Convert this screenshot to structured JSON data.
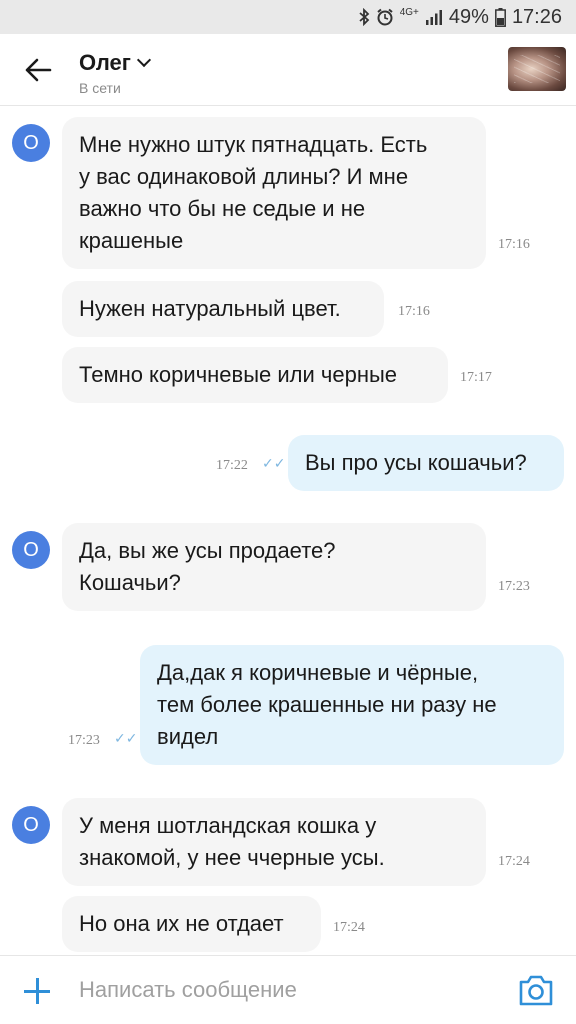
{
  "status_bar": {
    "network": "4G+",
    "battery": "49%",
    "time": "17:26"
  },
  "header": {
    "contact_name": "Олег",
    "contact_status": "В сети"
  },
  "messages": [
    {
      "direction": "in",
      "text": "Мне нужно штук пятнадцать. Есть\nу вас одинаковой длины? И мне\nважно что бы не седые и не\nкрашеные",
      "time": "17:16",
      "avatar_letter": "O"
    },
    {
      "direction": "in",
      "text": "Нужен натуральный цвет.",
      "time": "17:16"
    },
    {
      "direction": "in",
      "text": "Темно коричневые или черные",
      "time": "17:17"
    },
    {
      "direction": "out",
      "text": "Вы про усы кошачьи?",
      "time": "17:22",
      "status": "read"
    },
    {
      "direction": "in",
      "text": "Да, вы же усы продаете?\nКошачьи?",
      "time": "17:23",
      "avatar_letter": "O"
    },
    {
      "direction": "out",
      "text": "Да,дак я коричневые и чёрные,\nтем более крашенные ни разу не\nвидел",
      "time": "17:23",
      "status": "read"
    },
    {
      "direction": "in",
      "text": "У меня шотландская кошка у\nзнакомой, у нее ччерные усы.",
      "time": "17:24",
      "avatar_letter": "O"
    },
    {
      "direction": "in",
      "text": "Но она их не отдает",
      "time": "17:24"
    }
  ],
  "composer": {
    "placeholder": "Написать сообщение"
  },
  "colors": {
    "accent": "#2f8fd8",
    "avatar": "#4a7fe0",
    "incoming_bubble": "#f5f5f5",
    "outgoing_bubble": "#e3f3fc",
    "read_ticks": "#7fb7e0"
  }
}
